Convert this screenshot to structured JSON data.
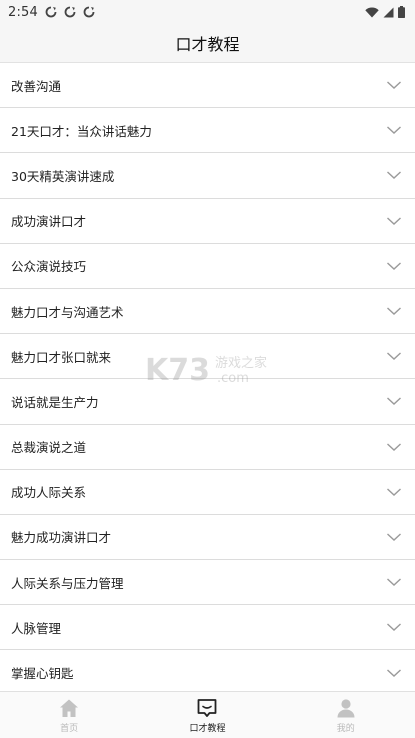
{
  "status_bar": {
    "time": "2:54",
    "notification_icons": [
      "sync-icon",
      "sync-icon",
      "sync-icon"
    ],
    "system_icons": [
      "wifi-icon",
      "signal-icon",
      "battery-icon"
    ]
  },
  "header": {
    "title": "口才教程"
  },
  "list": {
    "items": [
      "改善沟通",
      "21天口才：当众讲话魅力",
      "30天精英演讲速成",
      "成功演讲口才",
      "公众演说技巧",
      "魅力口才与沟通艺术",
      "魅力口才张口就来",
      "说话就是生产力",
      "总裁演说之道",
      "成功人际关系",
      "魅力成功演讲口才",
      "人际关系与压力管理",
      "人脉管理",
      "掌握心钥匙"
    ],
    "chevron_icon": "chevron-down-icon"
  },
  "watermark": {
    "logo_text": "K73",
    "site_text": "游戏之家",
    "domain_text": ".com"
  },
  "tab_bar": {
    "tabs": [
      {
        "label": "首页",
        "icon": "home-icon",
        "active": false
      },
      {
        "label": "口才教程",
        "icon": "chat-icon",
        "active": true
      },
      {
        "label": "我的",
        "icon": "person-icon",
        "active": false
      }
    ]
  },
  "colors": {
    "bar_background": "#f6f6f6",
    "divider": "#dcdcdc",
    "active_tab": "#222222",
    "inactive_tab": "#b9b9b9"
  }
}
